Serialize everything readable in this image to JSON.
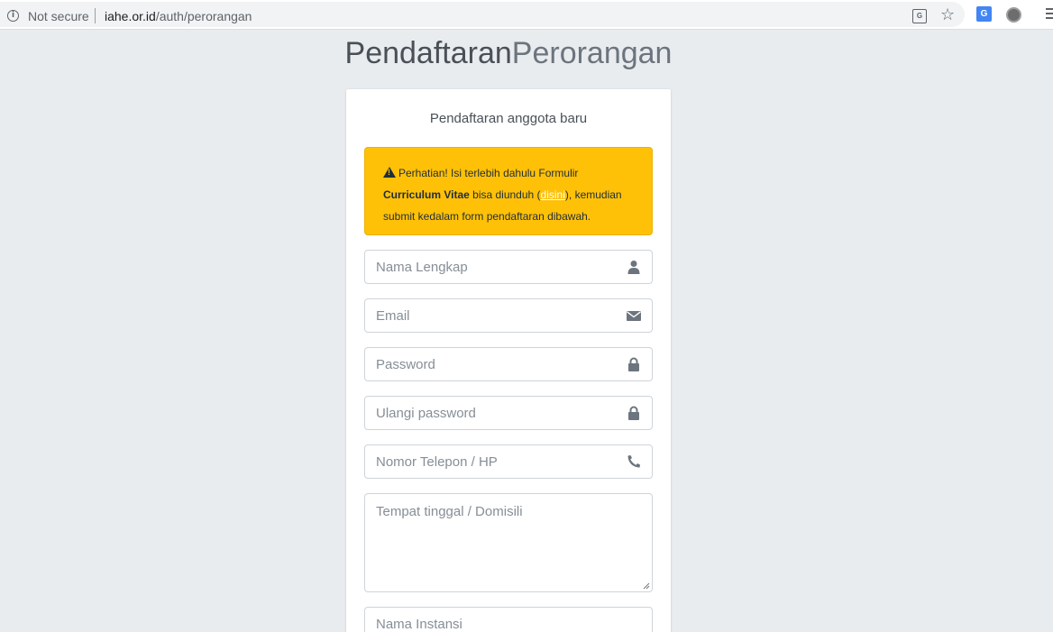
{
  "browser": {
    "security_label": "Not secure",
    "url_host": "iahe.or.id",
    "url_path": "/auth/perorangan"
  },
  "page": {
    "title_strong": "Pendaftaran",
    "title_light": "Perorangan"
  },
  "card": {
    "message": "Pendaftaran anggota baru",
    "alert": {
      "line1": "Perhatian! Isi terlebih dahulu Formulir",
      "bold": "Curriculum Vitae",
      "middle": " bisa diunduh (",
      "link": "disini",
      "after_link": "), kemudian",
      "line3": "submit kedalam form pendaftaran dibawah."
    },
    "fields": {
      "name": "Nama Lengkap",
      "email": "Email",
      "password": "Password",
      "password_repeat": "Ulangi password",
      "phone": "Nomor Telepon / HP",
      "address": "Tempat tinggal / Domisili",
      "institution": "Nama Instansi"
    }
  },
  "colors": {
    "alert_bg": "#ffc107",
    "page_bg": "#e9ecef",
    "icon": "#6c757d"
  }
}
